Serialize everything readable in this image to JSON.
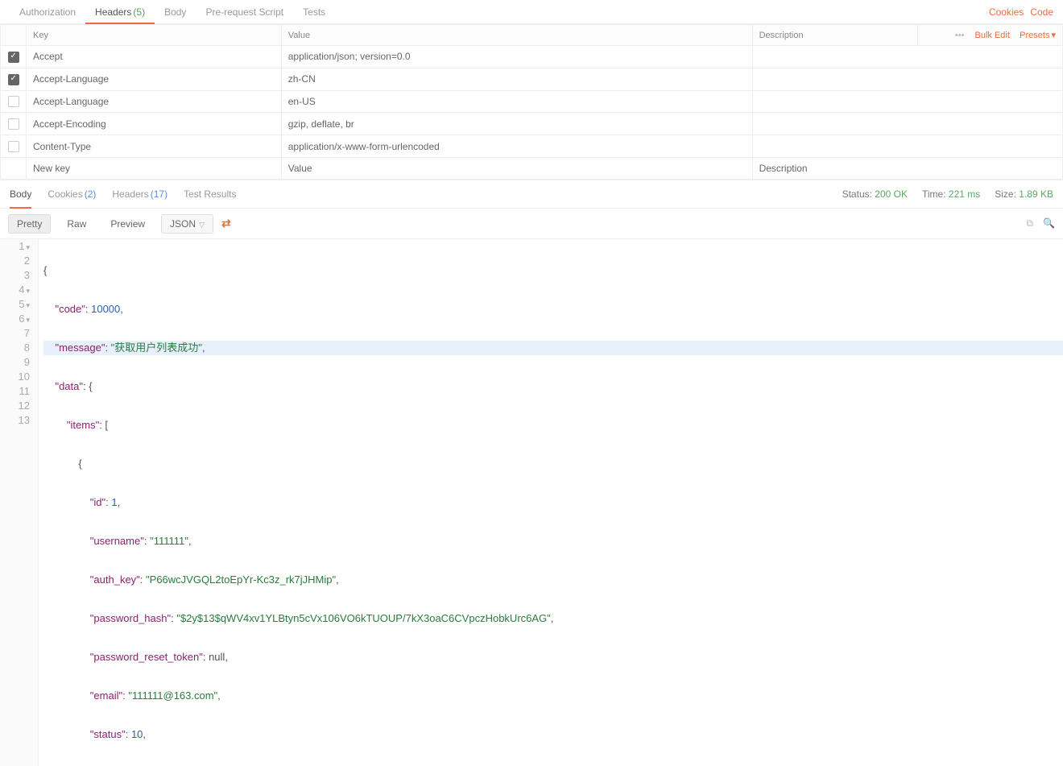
{
  "request_tabs": {
    "items": [
      {
        "label": "Authorization",
        "count": null,
        "active": false
      },
      {
        "label": "Headers",
        "count": "(5)",
        "active": true
      },
      {
        "label": "Body",
        "count": null,
        "active": false
      },
      {
        "label": "Pre-request Script",
        "count": null,
        "active": false
      },
      {
        "label": "Tests",
        "count": null,
        "active": false
      }
    ],
    "cookies_link": "Cookies",
    "code_link": "Code"
  },
  "headers_table": {
    "cols": {
      "key": "Key",
      "value": "Value",
      "desc": "Description"
    },
    "actions": {
      "dots": "•••",
      "bulk_edit": "Bulk Edit",
      "presets": "Presets"
    },
    "rows": [
      {
        "checked": true,
        "key": "Accept",
        "value": "application/json; version=0.0",
        "desc": ""
      },
      {
        "checked": true,
        "key": "Accept-Language",
        "value": "zh-CN",
        "desc": ""
      },
      {
        "checked": false,
        "key": "Accept-Language",
        "value": "en-US",
        "desc": ""
      },
      {
        "checked": false,
        "key": "Accept-Encoding",
        "value": "gzip, deflate, br",
        "desc": ""
      },
      {
        "checked": false,
        "key": "Content-Type",
        "value": "application/x-www-form-urlencoded",
        "desc": ""
      }
    ],
    "placeholders": {
      "key": "New key",
      "value": "Value",
      "desc": "Description"
    }
  },
  "response_tabs": {
    "items": [
      {
        "label": "Body",
        "count": null,
        "active": true
      },
      {
        "label": "Cookies",
        "count": "(2)",
        "active": false
      },
      {
        "label": "Headers",
        "count": "(17)",
        "active": false
      },
      {
        "label": "Test Results",
        "count": null,
        "active": false
      }
    ],
    "meta": {
      "status_lbl": "Status:",
      "status_val": "200 OK",
      "time_lbl": "Time:",
      "time_val": "221 ms",
      "size_lbl": "Size:",
      "size_val": "1.89 KB"
    }
  },
  "view_bar": {
    "pretty": "Pretty",
    "raw": "Raw",
    "preview": "Preview",
    "format": "JSON"
  },
  "code": {
    "lines": [
      "1",
      "2",
      "3",
      "4",
      "5",
      "6",
      "7",
      "8",
      "9",
      "10",
      "11",
      "12",
      "13"
    ],
    "json": {
      "code_key": "\"code\"",
      "code_val": "10000",
      "message_key": "\"message\"",
      "message_val": "\"获取用户列表成功\"",
      "data_key": "\"data\"",
      "items_key": "\"items\"",
      "id_key": "\"id\"",
      "id_val": "1",
      "username_key": "\"username\"",
      "username_val": "\"111111\"",
      "auth_key_key": "\"auth_key\"",
      "auth_key_val": "\"P66wcJVGQL2toEpYr-Kc3z_rk7jJHMip\"",
      "pwh_key": "\"password_hash\"",
      "pwh_val": "\"$2y$13$qWV4xv1YLBtyn5cVx106VO6kTUOUP/7kX3oaC6CVpczHobkUrc6AG\"",
      "prt_key": "\"password_reset_token\"",
      "prt_val": "null",
      "email_key": "\"email\"",
      "email_val": "\"111111@163.com\"",
      "status_key": "\"status\"",
      "status_val": "10"
    }
  }
}
